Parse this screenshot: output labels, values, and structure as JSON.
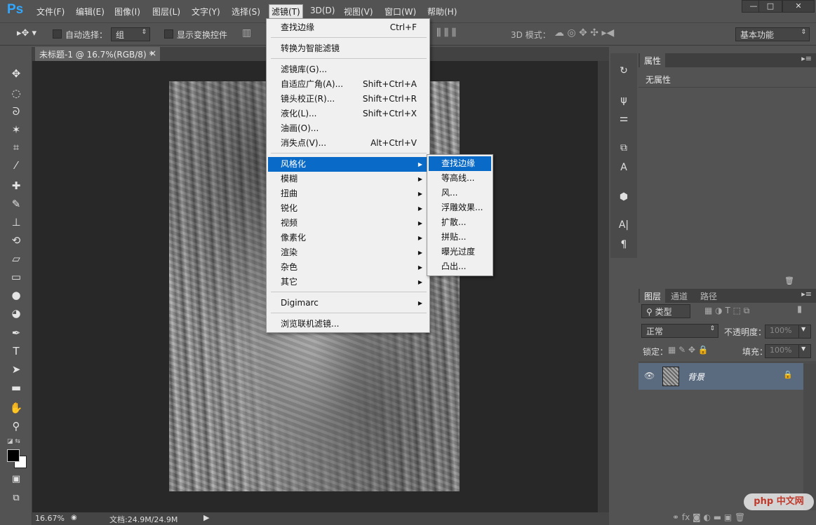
{
  "app_logo": "Ps",
  "menubar": [
    "文件(F)",
    "编辑(E)",
    "图像(I)",
    "图层(L)",
    "文字(Y)",
    "选择(S)",
    "滤镜(T)",
    "3D(D)",
    "视图(V)",
    "窗口(W)",
    "帮助(H)"
  ],
  "options": {
    "auto_select_label": "自动选择：",
    "auto_select_value": "组",
    "show_transform_label": "显示变换控件",
    "mode_3d_label": "3D 模式：",
    "workspace": "基本功能"
  },
  "document_tab": {
    "title": "未标题-1 @ 16.7%(RGB/8) *",
    "close": "×"
  },
  "status": {
    "zoom": "16.67%",
    "doc_info": "文档:24.9M/24.9M"
  },
  "filter_menu": {
    "items": [
      {
        "label": "查找边缘",
        "shortcut": "Ctrl+F"
      },
      {
        "label": "转换为智能滤镜"
      },
      {
        "label": "滤镜库(G)..."
      },
      {
        "label": "自适应广角(A)...",
        "shortcut": "Shift+Ctrl+A"
      },
      {
        "label": "镜头校正(R)...",
        "shortcut": "Shift+Ctrl+R"
      },
      {
        "label": "液化(L)...",
        "shortcut": "Shift+Ctrl+X"
      },
      {
        "label": "油画(O)..."
      },
      {
        "label": "消失点(V)...",
        "shortcut": "Alt+Ctrl+V"
      },
      {
        "label": "风格化"
      },
      {
        "label": "模糊"
      },
      {
        "label": "扭曲"
      },
      {
        "label": "锐化"
      },
      {
        "label": "视频"
      },
      {
        "label": "像素化"
      },
      {
        "label": "渲染"
      },
      {
        "label": "杂色"
      },
      {
        "label": "其它"
      },
      {
        "label": "Digimarc"
      },
      {
        "label": "浏览联机滤镜..."
      }
    ]
  },
  "stylize_submenu": [
    "查找边缘",
    "等高线...",
    "风...",
    "浮雕效果...",
    "扩散...",
    "拼贴...",
    "曝光过度",
    "凸出..."
  ],
  "properties_panel": {
    "tab": "属性",
    "content": "无属性"
  },
  "layers_panel": {
    "tabs": [
      "图层",
      "通道",
      "路径"
    ],
    "filter_kind": "类型",
    "blend_mode": "正常",
    "opacity_label": "不透明度：",
    "opacity_value": "100%",
    "lock_label": "锁定：",
    "fill_label": "填充：",
    "fill_value": "100%",
    "layer_name": "背景"
  },
  "watermark": "php 中文网"
}
